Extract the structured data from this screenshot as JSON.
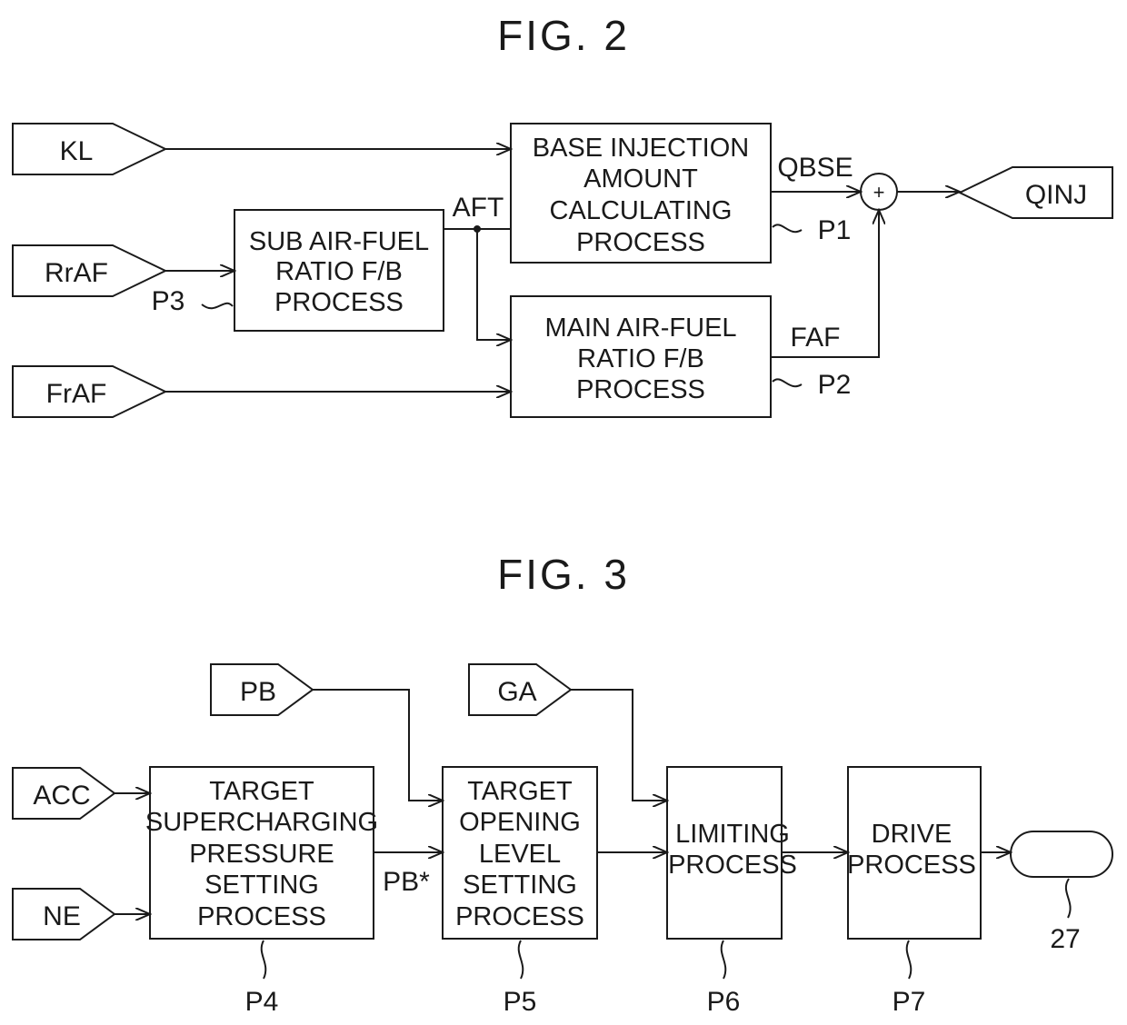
{
  "fig2": {
    "title": "FIG. 2",
    "inputs": {
      "kl": "KL",
      "rraf": "RrAF",
      "fraf": "FrAF"
    },
    "output": "QINJ",
    "blocks": {
      "base": [
        "BASE INJECTION",
        "AMOUNT",
        "CALCULATING",
        "PROCESS"
      ],
      "main": [
        "MAIN AIR-FUEL",
        "RATIO F/B",
        "PROCESS"
      ],
      "sub": [
        "SUB AIR-FUEL",
        "RATIO F/B",
        "PROCESS"
      ]
    },
    "signals": {
      "aft": "AFT",
      "qbse": "QBSE",
      "faf": "FAF"
    },
    "summer_symbol": "+",
    "refs": {
      "p1": "P1",
      "p2": "P2",
      "p3": "P3"
    }
  },
  "fig3": {
    "title": "FIG. 3",
    "inputs": {
      "pb": "PB",
      "ga": "GA",
      "acc": "ACC",
      "ne": "NE"
    },
    "blocks": {
      "p4": [
        "TARGET",
        "SUPERCHARGING",
        "PRESSURE",
        "SETTING",
        "PROCESS"
      ],
      "p5": [
        "TARGET",
        "OPENING",
        "LEVEL",
        "SETTING",
        "PROCESS"
      ],
      "p6": [
        "LIMITING",
        "PROCESS"
      ],
      "p7": [
        "DRIVE",
        "PROCESS"
      ]
    },
    "signals": {
      "pbstar": "PB*"
    },
    "refs": {
      "p4": "P4",
      "p5": "P5",
      "p6": "P6",
      "p7": "P7",
      "actuator": "27"
    }
  }
}
